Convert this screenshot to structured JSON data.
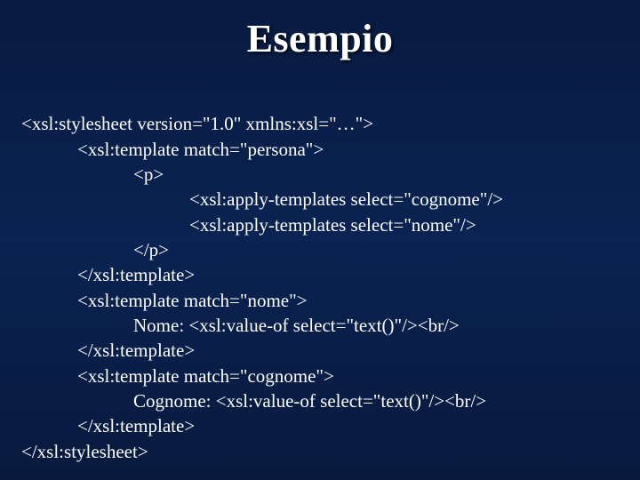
{
  "title": "Esempio",
  "code": {
    "l1": "<xsl:stylesheet version=\"1.0\" xmlns:xsl=\"…\">",
    "l2": "            <xsl:template match=\"persona\">",
    "l3": "                        <p>",
    "l4": "                                    <xsl:apply-templates select=\"cognome\"/>",
    "l5": "                                    <xsl:apply-templates select=\"nome\"/>",
    "l6": "                        </p>",
    "l7": "            </xsl:template>",
    "l8": "            <xsl:template match=\"nome\">",
    "l9": "                        Nome: <xsl:value-of select=\"text()\"/><br/>",
    "l10": "            </xsl:template>",
    "l11": "            <xsl:template match=\"cognome\">",
    "l12": "                        Cognome: <xsl:value-of select=\"text()\"/><br/>",
    "l13": "            </xsl:template>",
    "l14": "</xsl:stylesheet>"
  }
}
